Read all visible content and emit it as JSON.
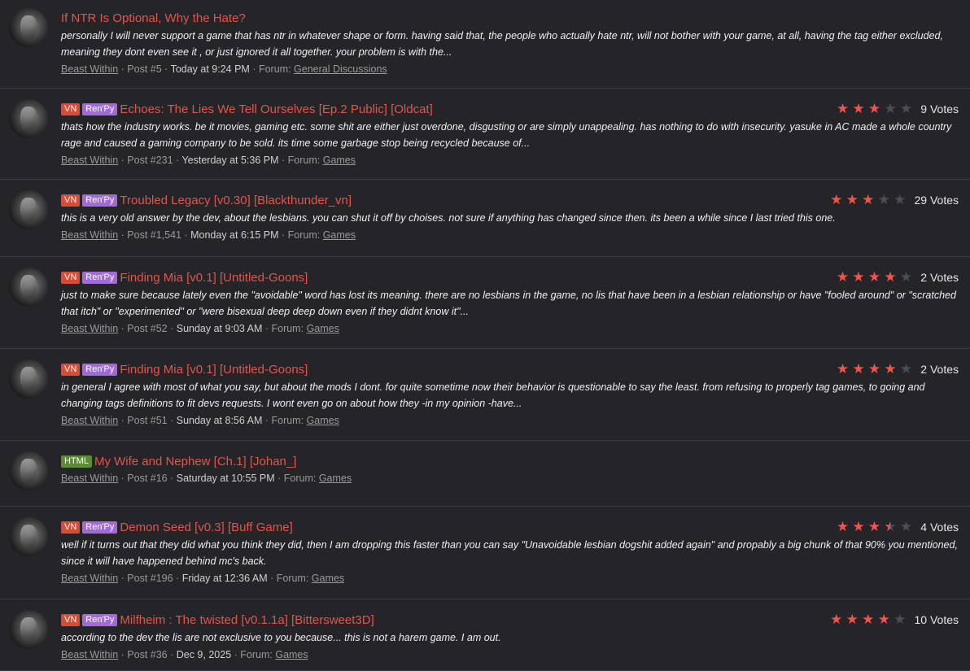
{
  "posts": [
    {
      "tags": [],
      "title": "If NTR Is Optional, Why the Hate?",
      "snippet": "personally I will never support a game that has ntr in whatever shape or form. having said that, the people who actually hate ntr, will not bother with your game, at all, having the tag either excluded, meaning they dont even see it , or just ignored it all together. your problem is with the...",
      "author": "Beast Within",
      "post": "Post #5",
      "date": "Today at 9:24 PM",
      "forum_label": "Forum:",
      "forum": "General Discussions",
      "rating": null,
      "votes": ""
    },
    {
      "tags": [
        "VN",
        "Ren'Py"
      ],
      "title": "Echoes: The Lies We Tell Ourselves [Ep.2 Public] [Oldcat]",
      "snippet": "thats how the industry works. be it movies, gaming etc. some shit are either just overdone, disgusting or are simply unappealing. has nothing to do with insecurity. yasuke in AC made a whole country rage and caused a gaming company to be sold. its time some garbage stop being recycled because of...",
      "author": "Beast Within",
      "post": "Post #231",
      "date": "Yesterday at 5:36 PM",
      "forum_label": "Forum:",
      "forum": "Games",
      "rating": 3,
      "votes": "9 Votes"
    },
    {
      "tags": [
        "VN",
        "Ren'Py"
      ],
      "title": "Troubled Legacy [v0.30] [Blackthunder_vn]",
      "snippet": "this is a very old answer by the dev, about the lesbians. you can shut it off by choises. not sure if anything has changed since then. its been a while since I last tried this one.",
      "author": "Beast Within",
      "post": "Post #1,541",
      "date": "Monday at 6:15 PM",
      "forum_label": "Forum:",
      "forum": "Games",
      "rating": 3,
      "votes": "29 Votes"
    },
    {
      "tags": [
        "VN",
        "Ren'Py"
      ],
      "title": "Finding Mia [v0.1] [Untitled-Goons]",
      "snippet": "just to make sure because lately even the \"avoidable\" word has lost its meaning. there are no lesbians in the game, no lis that have been in a lesbian relationship or have \"fooled around\" or \"scratched that itch\" or \"experimented\" or \"were bisexual deep deep down even if they didnt know it\"...",
      "author": "Beast Within",
      "post": "Post #52",
      "date": "Sunday at 9:03 AM",
      "forum_label": "Forum:",
      "forum": "Games",
      "rating": 4,
      "votes": "2 Votes"
    },
    {
      "tags": [
        "VN",
        "Ren'Py"
      ],
      "title": "Finding Mia [v0.1] [Untitled-Goons]",
      "snippet": "in general I agree with most of what you say, but about the mods I dont. for quite sometime now their behavior is questionable to say the least. from refusing to properly tag games, to going and changing tags definitions to fit devs requests. I wont even go on about how they -in my opinion -have...",
      "author": "Beast Within",
      "post": "Post #51",
      "date": "Sunday at 8:56 AM",
      "forum_label": "Forum:",
      "forum": "Games",
      "rating": 4,
      "votes": "2 Votes"
    },
    {
      "tags": [
        "HTML"
      ],
      "title": "My Wife and Nephew [Ch.1] [Johan_]",
      "snippet": "",
      "author": "Beast Within",
      "post": "Post #16",
      "date": "Saturday at 10:55 PM",
      "forum_label": "Forum:",
      "forum": "Games",
      "rating": null,
      "votes": ""
    },
    {
      "tags": [
        "VN",
        "Ren'Py"
      ],
      "title": "Demon Seed [v0.3] [Buff Game]",
      "snippet": "well if it turns out that they did what you think they did, then I am dropping this faster than you can say \"Unavoidable lesbian dogshit added again\" and propably a big chunk of that 90% you mentioned, since it will have happened behind mc's back.",
      "author": "Beast Within",
      "post": "Post #196",
      "date": "Friday at 12:36 AM",
      "forum_label": "Forum:",
      "forum": "Games",
      "rating": 3.5,
      "votes": "4 Votes"
    },
    {
      "tags": [
        "VN",
        "Ren'Py"
      ],
      "title": "Milfheim : The twisted [v0.1.1a] [Bittersweet3D]",
      "snippet": "according to the dev the lis are not exclusive to you because... this is not a harem game. I am out.",
      "author": "Beast Within",
      "post": "Post #36",
      "date": "Dec 9, 2025",
      "forum_label": "Forum:",
      "forum": "Games",
      "rating": 4,
      "votes": "10 Votes"
    }
  ],
  "star_glyph": "★",
  "colors": {
    "accent": "#e0574a",
    "star_on": "#f0544b",
    "star_off": "#4e4e52",
    "tag_vn": "#d84b35",
    "tag_renpy": "#a26ad8",
    "tag_html": "#5d8d32",
    "background": "#242429"
  }
}
